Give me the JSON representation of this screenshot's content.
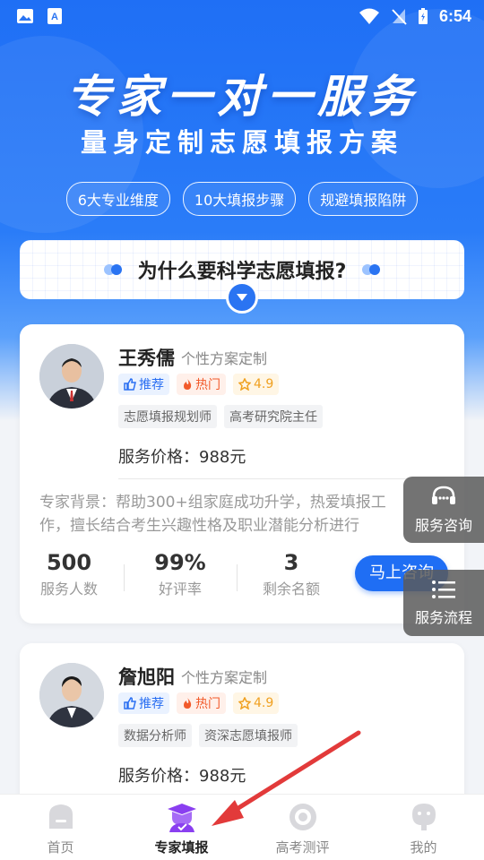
{
  "statusbar": {
    "time": "6:54"
  },
  "hero": {
    "title": "专家一对一服务",
    "subtitle": "量身定制志愿填报方案",
    "tags": [
      "6大专业维度",
      "10大填报步骤",
      "规避填报陷阱"
    ]
  },
  "why": {
    "title": "为什么要科学志愿填报?"
  },
  "experts": [
    {
      "name": "王秀儒",
      "subtitle": "个性方案定制",
      "badges": {
        "recommend": "推荐",
        "hot": "热门",
        "rating": "4.9"
      },
      "roles": [
        "志愿填报规划师",
        "高考研究院主任"
      ],
      "price": "服务价格：988元",
      "bio": "专家背景：帮助300+组家庭成功升学，热爱填报工作，擅长结合考生兴趣性格及职业潜能分析进行",
      "stats": [
        {
          "value": "500",
          "label": "服务人数"
        },
        {
          "value": "99%",
          "label": "好评率"
        },
        {
          "value": "3",
          "label": "剩余名额"
        }
      ],
      "button": "马上咨询"
    },
    {
      "name": "詹旭阳",
      "subtitle": "个性方案定制",
      "badges": {
        "recommend": "推荐",
        "hot": "热门",
        "rating": "4.9"
      },
      "roles": [
        "数据分析师",
        "资深志愿填报师"
      ],
      "price": "服务价格：988元"
    }
  ],
  "floating": {
    "consult": "服务咨询",
    "process": "服务流程"
  },
  "tabs": [
    {
      "label": "首页",
      "icon": "home-icon"
    },
    {
      "label": "专家填报",
      "icon": "graduate-icon",
      "active": true
    },
    {
      "label": "高考测评",
      "icon": "target-icon"
    },
    {
      "label": "我的",
      "icon": "profile-icon"
    }
  ],
  "colors": {
    "primary": "#1f6ef4",
    "active_tab": "#8a3ff0",
    "arrow": "#e23a3a"
  }
}
